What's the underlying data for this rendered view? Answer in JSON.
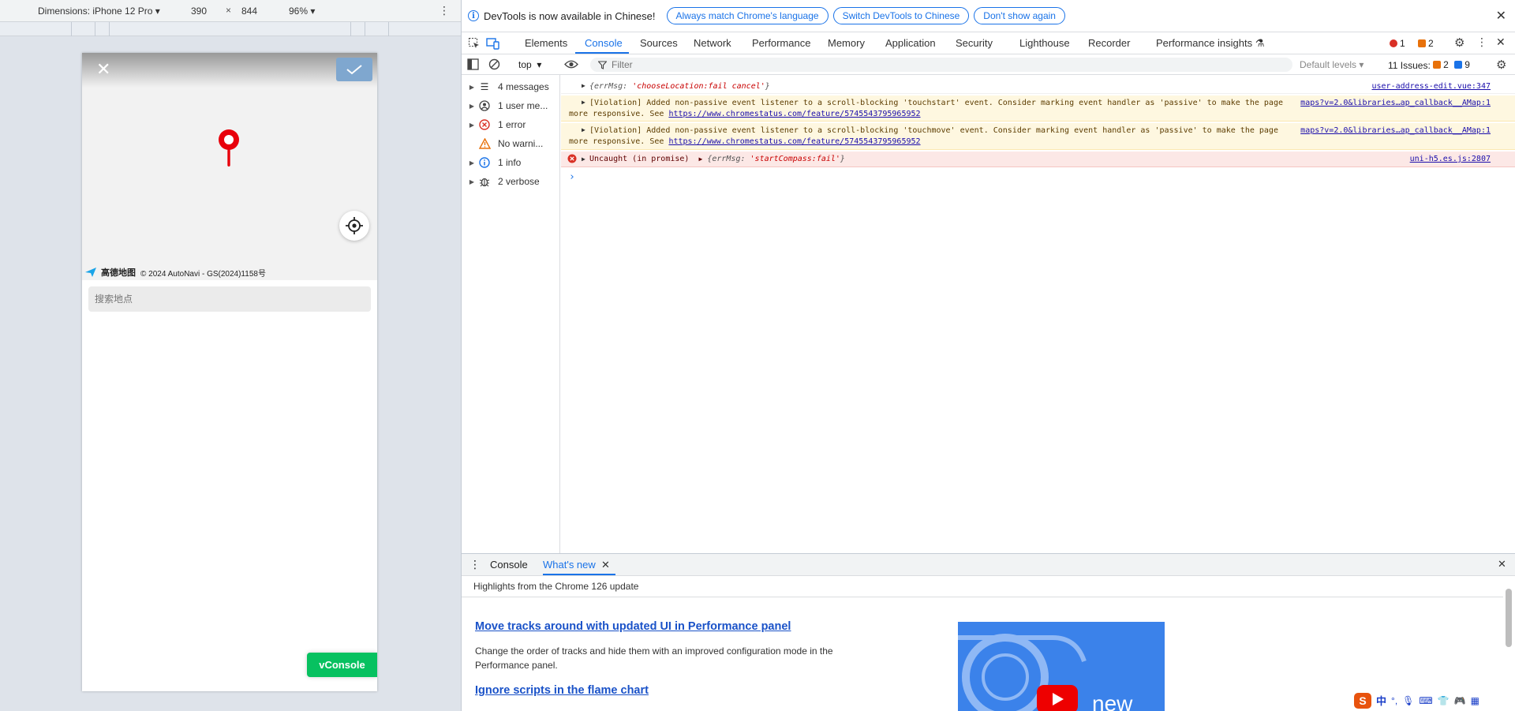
{
  "device_toolbar": {
    "dimensions_label": "Dimensions: iPhone 12 Pro",
    "width": "390",
    "times": "×",
    "height": "844",
    "zoom": "96%"
  },
  "phone": {
    "map_brand": "高德地图",
    "map_copyright": "© 2024 AutoNavi - GS(2024)1158号",
    "search_placeholder": "搜索地点",
    "vconsole_label": "vConsole"
  },
  "infobar": {
    "message": "DevTools is now available in Chinese!",
    "btn_match": "Always match Chrome's language",
    "btn_switch": "Switch DevTools to Chinese",
    "btn_dont_show": "Don't show again"
  },
  "tabs": {
    "elements": "Elements",
    "console": "Console",
    "sources": "Sources",
    "network": "Network",
    "performance": "Performance",
    "memory": "Memory",
    "application": "Application",
    "security": "Security",
    "lighthouse": "Lighthouse",
    "recorder": "Recorder",
    "performance_insights": "Performance insights",
    "error_count": "1",
    "warning_count": "2"
  },
  "console_toolbar": {
    "context": "top",
    "filter_placeholder": "Filter",
    "default_levels": "Default levels",
    "issues_label": "11 Issues:",
    "issues_warn": "2",
    "issues_info": "9"
  },
  "sidebar": {
    "items": [
      {
        "label": "4 messages",
        "icon": "list-icon"
      },
      {
        "label": "1 user me...",
        "icon": "user-icon"
      },
      {
        "label": "1 error",
        "icon": "error-icon"
      },
      {
        "label": "No warni...",
        "icon": "warning-icon"
      },
      {
        "label": "1 info",
        "icon": "info-icon"
      },
      {
        "label": "2 verbose",
        "icon": "bug-icon"
      }
    ]
  },
  "log": {
    "row1": {
      "key": "{errMsg: ",
      "value": "'chooseLocation:fail cancel'",
      "close": "}",
      "source": "user-address-edit.vue:347"
    },
    "row2": {
      "line1": "[Violation] Added non-passive event listener to a scroll-blocking 'touchstart' event. Consider marking event handler as 'passive' to make the page",
      "line2_prefix": "more responsive. See ",
      "link": "https://www.chromestatus.com/feature/5745543795965952",
      "source": "maps?v=2.0&libraries…ap_callback__AMap:1"
    },
    "row3": {
      "line1": "[Violation] Added non-passive event listener to a scroll-blocking 'touchmove' event. Consider marking event handler as 'passive' to make the page",
      "line2_prefix": "more responsive. See ",
      "link": "https://www.chromestatus.com/feature/5745543795965952",
      "source": "maps?v=2.0&libraries…ap_callback__AMap:1"
    },
    "row4": {
      "prefix": "Uncaught (in promise)",
      "key": "{errMsg: ",
      "value": "'startCompass:fail'",
      "close": "}",
      "source": "uni-h5.es.js:2807"
    },
    "prompt": "›"
  },
  "drawer": {
    "tab_console": "Console",
    "tab_whats_new": "What's new",
    "highlights": "Highlights from the Chrome 126 update",
    "item1_title": "Move tracks around with updated UI in Performance panel",
    "item1_desc": "Change the order of tracks and hide them with an improved configuration mode in the Performance panel.",
    "item2_title": "Ignore scripts in the flame chart",
    "video_label": "new"
  },
  "ime": {
    "lang": "中"
  }
}
